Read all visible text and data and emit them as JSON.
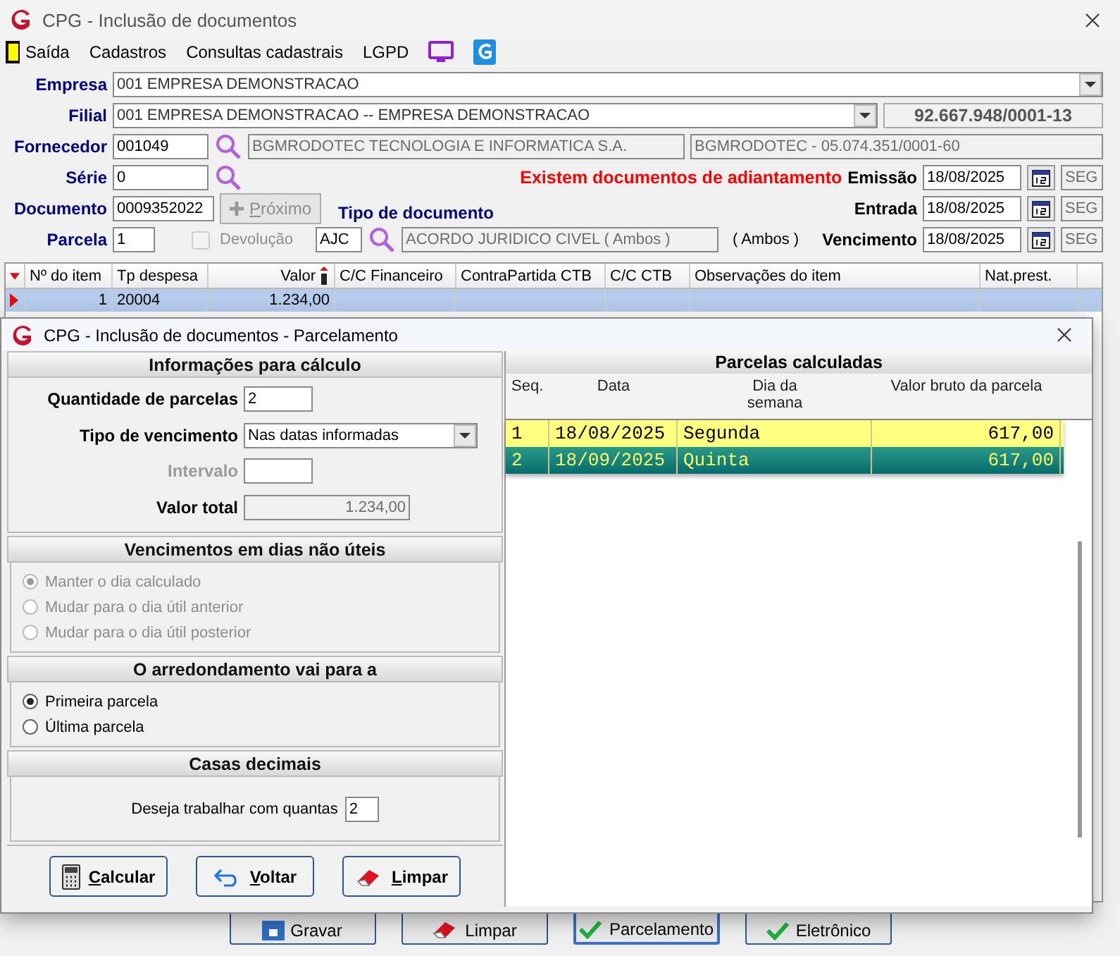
{
  "window": {
    "title": "CPG - Inclusão de documentos"
  },
  "menu": [
    {
      "label": "Saída",
      "kind": "exit"
    },
    {
      "label": "Cadastros",
      "kind": "text"
    },
    {
      "label": "Consultas cadastrais",
      "kind": "text"
    },
    {
      "label": "LGPD",
      "kind": "text"
    },
    {
      "kind": "monitor"
    },
    {
      "kind": "app"
    }
  ],
  "form": {
    "empresa": {
      "label": "Empresa",
      "value": "001 EMPRESA DEMONSTRACAO"
    },
    "filial": {
      "label": "Filial",
      "value": "001 EMPRESA DEMONSTRACAO -- EMPRESA DEMONSTRACAO",
      "cnpj": "92.667.948/0001-13"
    },
    "fornecedor": {
      "label": "Fornecedor",
      "code": "001049",
      "name": "BGMRODOTEC TECNOLOGIA E INFORMATICA S.A.",
      "short": "BGMRODOTEC - 05.074.351/0001-60"
    },
    "serie": {
      "label": "Série",
      "value": "0"
    },
    "documento": {
      "label": "Documento",
      "value": "0009352022",
      "next": {
        "label": "Próximo",
        "disabled": true
      }
    },
    "parcela": {
      "label": "Parcela",
      "value": "1"
    },
    "devolucao": {
      "label": "Devolução",
      "checked": false,
      "disabled": true
    },
    "tipo_documento": {
      "label": "Tipo de documento",
      "code": "AJC",
      "name": "ACORDO JURIDICO CIVEL ( Ambos )",
      "scope": "( Ambos )"
    },
    "alert": "Existem documentos de adiantamento",
    "dates": [
      {
        "label": "Emissão",
        "value": "18/08/2025",
        "weekday": "SEG"
      },
      {
        "label": "Entrada",
        "value": "18/08/2025",
        "weekday": "SEG"
      },
      {
        "label": "Vencimento",
        "value": "18/08/2025",
        "weekday": "SEG"
      }
    ]
  },
  "grid": {
    "columns": [
      {
        "label": "Nº do item",
        "sorted": false
      },
      {
        "label": "Tp despesa",
        "sorted": false
      },
      {
        "label": "Valor",
        "sorted": true
      },
      {
        "label": "C/C Financeiro",
        "sorted": false
      },
      {
        "label": "ContraPartida CTB",
        "sorted": false
      },
      {
        "label": "C/C CTB",
        "sorted": false
      },
      {
        "label": "Observações do item",
        "sorted": false
      },
      {
        "label": "Nat.prest.",
        "sorted": false
      }
    ],
    "rows": [
      {
        "cells": [
          "1",
          "20004",
          "1.234,00"
        ],
        "selected": true
      }
    ]
  },
  "bottom_buttons": [
    {
      "label": "Gravar",
      "kind": "save",
      "selected": false
    },
    {
      "label": "Limpar",
      "kind": "eraser",
      "selected": false
    },
    {
      "label": "Parcelamento",
      "kind": "check",
      "selected": true
    },
    {
      "label": "Eletrônico",
      "kind": "check",
      "selected": false
    }
  ],
  "dialog": {
    "title": "CPG - Inclusão de documentos - Parcelamento",
    "calc": {
      "title": "Informações para cálculo",
      "fields": [
        {
          "label": "Quantidade de parcelas",
          "value": "2",
          "kind": "input",
          "disabled": false
        },
        {
          "label": "Tipo de vencimento",
          "value": "Nas datas informadas",
          "kind": "select",
          "disabled": false
        },
        {
          "label": "Intervalo",
          "kind": "input",
          "disabled": true
        },
        {
          "label": "Valor total",
          "value": "1.234,00",
          "kind": "readonly",
          "disabled": false
        }
      ]
    },
    "nonbusiness": {
      "title": "Vencimentos em dias não úteis",
      "options": [
        {
          "label": "Manter o dia calculado",
          "selected": true,
          "disabled": true
        },
        {
          "label": "Mudar para o dia útil anterior",
          "selected": false,
          "disabled": true
        },
        {
          "label": "Mudar para o dia útil posterior",
          "selected": false,
          "disabled": true
        }
      ]
    },
    "rounding": {
      "title": "O arredondamento vai para a",
      "options": [
        {
          "label": "Primeira parcela",
          "selected": true,
          "disabled": false
        },
        {
          "label": "Última parcela",
          "selected": false,
          "disabled": false
        }
      ]
    },
    "decimals": {
      "title": "Casas decimais",
      "label": "Deseja trabalhar com quantas",
      "value": "2"
    },
    "buttons": [
      {
        "label": "Calcular",
        "kind": "calculator"
      },
      {
        "label": "Voltar",
        "kind": "back"
      },
      {
        "label": "Limpar",
        "kind": "eraser"
      }
    ],
    "installments": {
      "title": "Parcelas calculadas",
      "columns": [
        "Seq.",
        "Data",
        "Dia da semana",
        "Valor bruto da parcela"
      ],
      "rows": [
        {
          "seq": "1",
          "date": "18/08/2025",
          "weekday": "Segunda",
          "amount": "617,00",
          "selected": false
        },
        {
          "seq": "2",
          "date": "18/09/2025",
          "weekday": "Quinta",
          "amount": "617,00",
          "selected": true
        }
      ]
    }
  }
}
